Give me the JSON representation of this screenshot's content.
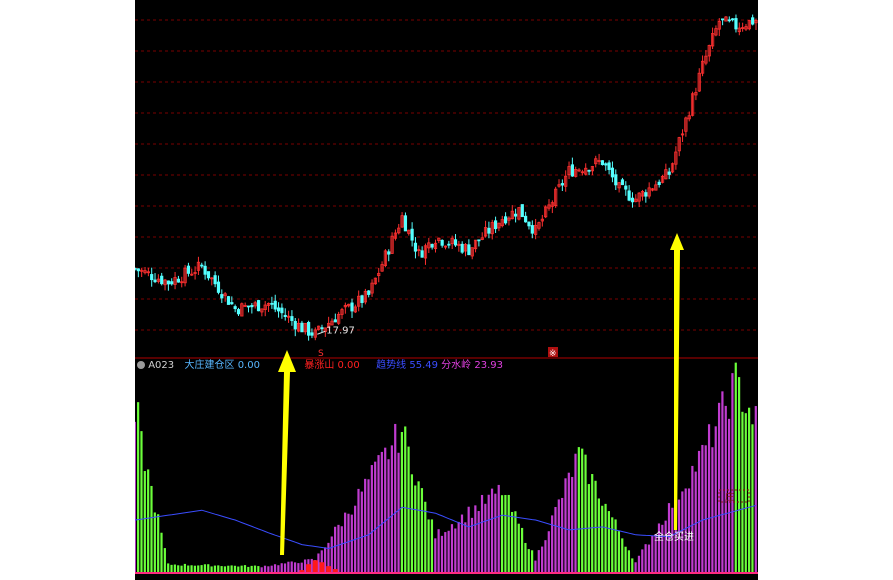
{
  "indicator_header": {
    "code": "A023",
    "items": [
      {
        "label": "大庄建仓区",
        "value": "0.00",
        "color": "#58b7ff"
      },
      {
        "label": "暴涨山",
        "value": "0.00",
        "color": "#ff2020"
      },
      {
        "label": "趋势线",
        "value": "55.49",
        "color": "#3a4dff"
      },
      {
        "label": "分水岭",
        "value": "23.93",
        "color": "#e040e0"
      }
    ]
  },
  "annotations": {
    "low_price_label": "17.97",
    "marker_s": "S",
    "marker_star": "※",
    "buy_signal_label": "全仓买进",
    "faint_label": "庄"
  },
  "colors": {
    "background": "#000000",
    "grid": "#7a0000",
    "up_candle": "#ff3030",
    "down_candle": "#54ffff",
    "arrow": "#ffff00",
    "green_bar": "#6bff3a",
    "magenta_bar": "#c03cd0",
    "red_bar": "#ff1a1a",
    "trend_line": "#3a4dff",
    "baseline": "#ff2a80"
  },
  "chart_data": [
    {
      "type": "candlestick",
      "title": "",
      "xlabel": "",
      "ylabel": "",
      "grid": true,
      "price_points": [
        {
          "i": 0,
          "price": 23.4
        },
        {
          "i": 10,
          "price": 22.3
        },
        {
          "i": 20,
          "price": 23.6
        },
        {
          "i": 30,
          "price": 20.1
        },
        {
          "i": 40,
          "price": 20.5
        },
        {
          "i": 50,
          "price": 18.5
        },
        {
          "i": 54,
          "price": 17.97
        },
        {
          "i": 60,
          "price": 19.4
        },
        {
          "i": 70,
          "price": 21.2
        },
        {
          "i": 80,
          "price": 27.7
        },
        {
          "i": 85,
          "price": 24.6
        },
        {
          "i": 90,
          "price": 26.0
        },
        {
          "i": 100,
          "price": 25.0
        },
        {
          "i": 110,
          "price": 27.6
        },
        {
          "i": 115,
          "price": 28.3
        },
        {
          "i": 120,
          "price": 26.5
        },
        {
          "i": 130,
          "price": 31.5
        },
        {
          "i": 140,
          "price": 32.3
        },
        {
          "i": 145,
          "price": 30.0
        },
        {
          "i": 150,
          "price": 29.2
        },
        {
          "i": 160,
          "price": 31.3
        },
        {
          "i": 165,
          "price": 35.7
        },
        {
          "i": 170,
          "price": 40.2
        },
        {
          "i": 175,
          "price": 43.9
        },
        {
          "i": 180,
          "price": 43.5
        },
        {
          "i": 186,
          "price": 44.0
        }
      ],
      "y_range": [
        16.5,
        45.5
      ],
      "low_label": "17.97"
    },
    {
      "type": "bar",
      "title": "",
      "series": [
        {
          "name": "暴涨山",
          "role": "red spike bars",
          "values_note": "small red bars near the low"
        },
        {
          "name": "趋势线",
          "role": "blue line"
        },
        {
          "name": "分水岭",
          "role": "magenta level"
        }
      ],
      "bar_peaks": [
        {
          "i": 2,
          "value": 135
        },
        {
          "i": 10,
          "value": 10
        },
        {
          "i": 38,
          "value": 8
        },
        {
          "i": 54,
          "value": 15
        },
        {
          "i": 62,
          "value": 55
        },
        {
          "i": 80,
          "value": 150
        },
        {
          "i": 90,
          "value": 40
        },
        {
          "i": 110,
          "value": 88
        },
        {
          "i": 120,
          "value": 15
        },
        {
          "i": 133,
          "value": 125
        },
        {
          "i": 150,
          "value": 12
        },
        {
          "i": 170,
          "value": 125
        },
        {
          "i": 180,
          "value": 200
        },
        {
          "i": 186,
          "value": 160
        }
      ],
      "trend_line": [
        {
          "i": 0,
          "value": 55
        },
        {
          "i": 10,
          "value": 60
        },
        {
          "i": 20,
          "value": 65
        },
        {
          "i": 30,
          "value": 55
        },
        {
          "i": 40,
          "value": 42
        },
        {
          "i": 50,
          "value": 30
        },
        {
          "i": 58,
          "value": 26
        },
        {
          "i": 70,
          "value": 40
        },
        {
          "i": 80,
          "value": 68
        },
        {
          "i": 90,
          "value": 62
        },
        {
          "i": 100,
          "value": 48
        },
        {
          "i": 110,
          "value": 60
        },
        {
          "i": 120,
          "value": 55
        },
        {
          "i": 130,
          "value": 45
        },
        {
          "i": 140,
          "value": 48
        },
        {
          "i": 150,
          "value": 40
        },
        {
          "i": 160,
          "value": 38
        },
        {
          "i": 170,
          "value": 55
        },
        {
          "i": 186,
          "value": 70
        }
      ],
      "y_range": [
        0,
        210
      ]
    }
  ]
}
